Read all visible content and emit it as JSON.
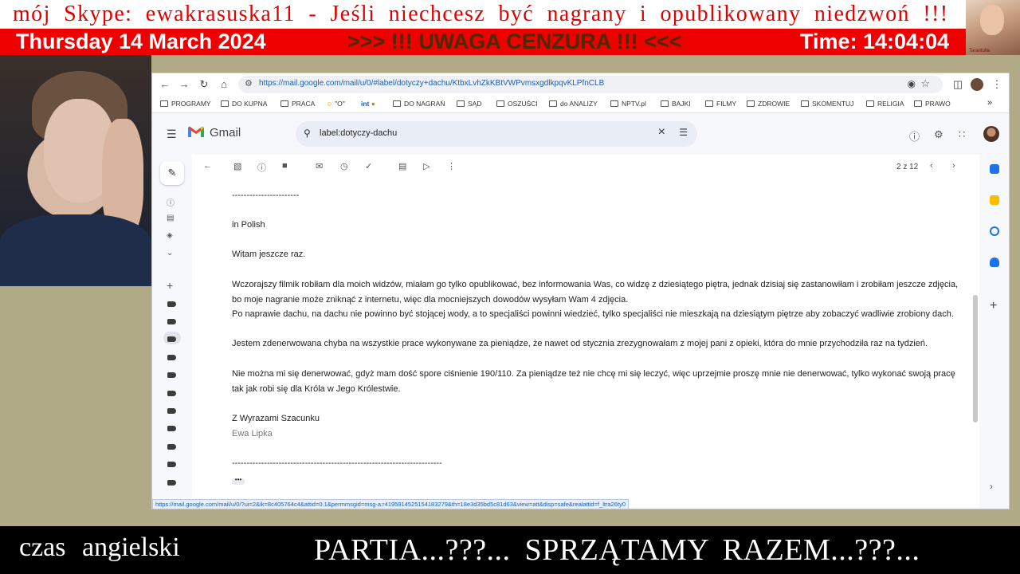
{
  "overlay": {
    "skype_line": "mój Skype: ewakrasuska11  - Jeśli  niechcesz  być  nagrany  i  opublikowany  niedzwoń !!!",
    "date": "Thursday 14 March 2024",
    "warning": ">>> !!! UWAGA  CENZURA !!! <<<",
    "time": "Time: 14:04:04",
    "avatar_caption": "Tarantulla"
  },
  "browser": {
    "url": "https://mail.google.com/mail/u/0/#label/dotyczy+dachu/KtbxLvhZkKBtVWPvmsxgdlkpqvKLPfnCLB",
    "bookmarks": [
      "PROGRAMY",
      "DO KUPNA",
      "PRACA",
      "\"O\"",
      "",
      "DO NAGRAŃ",
      "SĄD",
      "OSZUŚCI",
      "do ANALIZY",
      "NPTV.pl",
      "BAJKI",
      "FILMY",
      "ZDROWIE",
      "SKOMENTUJ",
      "RELIGIA",
      "PRAWO"
    ],
    "status_url": "https://mail.google.com/mail/u/0/?ui=2&ik=8c405764c4&attid=0.1&permmsgid=msg-a:r4195914525154183279&th=18e3d35bd5c81d63&view=att&disp=safe&realattid=f_ltra26ty0"
  },
  "gmail": {
    "app_name": "Gmail",
    "search_query": "label:dotyczy-dachu",
    "pager": "2 z 12"
  },
  "message": {
    "divider_top": "-----------------------",
    "lang_note": "in Polish",
    "greeting": "Witam jeszcze raz.",
    "para1": "Wczorajszy filmik robiłam dla moich widzów, miałam go tylko opublikować, bez informowania Was, co widzę z dziesiątego piętra, jednak dzisiaj się zastanowiłam i zrobiłam jeszcze zdjęcia, bo moje nagranie może zniknąć z internetu, więc dla mocniejszych dowodów wysyłam Wam 4 zdjęcia.",
    "para2": "Po naprawie dachu, na dachu nie powinno być stojącej wody, a to specjaliści powinni wiedzieć, tylko specjaliści nie mieszkają na dziesiątym piętrze aby zobaczyć wadliwie zrobiony dach.",
    "para3": "Jestem zdenerwowana chyba na wszystkie prace wykonywane za pieniądze, że nawet od stycznia zrezygnowałam z mojej pani z opieki, która do mnie przychodziła raz na tydzień.",
    "para4": "Nie można mi się denerwować, gdyż mam dość spore ciśnienie 190/110. Za pieniądze też nie chcę mi się leczyć, więc uprzejmie proszę mnie nie denerwować, tylko wykonać swoją pracę tak jak robi się dla Króla w Jego Królestwie.",
    "closing": "Z Wyrazami Szacunku",
    "signature": "Ewa Lipka",
    "divider_bottom": "------------------------------------------------------------------------",
    "ellipsis": "•••"
  },
  "ticker": {
    "left": "czas  angielski",
    "right": "PARTIA...???...  SPRZĄTAMY RAZEM...???..."
  },
  "colors": {
    "banner_red": "#ee0000",
    "skype_red": "#e00000",
    "gmail_bg": "#f6f8fc",
    "background_khaki": "#b0ab86"
  }
}
